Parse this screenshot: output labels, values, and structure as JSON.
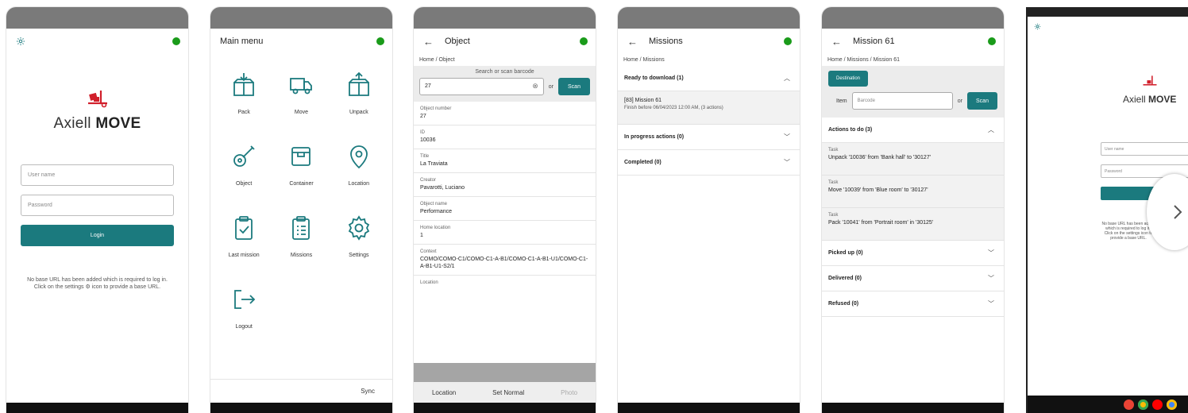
{
  "colors": {
    "accent": "#1b7a7e",
    "online": "#1a9b1a",
    "statusbar": "#7a7a7a"
  },
  "login": {
    "logo_light": "Axiell",
    "logo_bold": "MOVE",
    "username_placeholder": "User name",
    "password_placeholder": "Password",
    "login_label": "Login",
    "note": "No base URL has been added which is required to log in. Click on the settings ⚙ icon to provide a base URL."
  },
  "menu": {
    "title": "Main menu",
    "items": [
      {
        "label": "Pack",
        "icon": "pack-icon"
      },
      {
        "label": "Move",
        "icon": "truck-icon"
      },
      {
        "label": "Unpack",
        "icon": "unpack-icon"
      },
      {
        "label": "Object",
        "icon": "guitar-icon"
      },
      {
        "label": "Container",
        "icon": "container-icon"
      },
      {
        "label": "Location",
        "icon": "location-pin-icon"
      },
      {
        "label": "Last mission",
        "icon": "clipboard-check-icon"
      },
      {
        "label": "Missions",
        "icon": "clipboard-list-icon"
      },
      {
        "label": "Settings",
        "icon": "gear-icon"
      },
      {
        "label": "Logout",
        "icon": "logout-icon"
      }
    ],
    "sync_label": "Sync"
  },
  "object": {
    "title": "Object",
    "breadcrumb": "Home / Object",
    "search_label": "Search or scan barcode",
    "search_value": "27",
    "or_label": "or",
    "scan_label": "Scan",
    "props": [
      {
        "k": "Object number",
        "v": "27"
      },
      {
        "k": "ID",
        "v": "10036"
      },
      {
        "k": "Title",
        "v": "La Traviata"
      },
      {
        "k": "Creator",
        "v": "Pavarotti, Luciano"
      },
      {
        "k": "Object name",
        "v": "Performance"
      },
      {
        "k": "Home location",
        "v": "1"
      },
      {
        "k": "Context",
        "v": "COMO/COMO-C1/COMO-C1-A-B1/COMO-C1-A-B1-U1/COMO-C1-A-B1-U1-S2/1"
      },
      {
        "k": "Location",
        "v": ""
      }
    ],
    "bottom": {
      "location": "Location",
      "set_normal": "Set Normal",
      "photo": "Photo"
    }
  },
  "missions": {
    "title": "Missions",
    "breadcrumb": "Home / Missions",
    "ready_label": "Ready to download (1)",
    "mission_name": "[83] Mission 61",
    "mission_sub": "Finish before 06/04/2023 12:00 AM, (3 actions)",
    "in_progress_label": "In progress actions (0)",
    "completed_label": "Completed (0)"
  },
  "mission61": {
    "title": "Mission 61",
    "breadcrumb": "Home / Missions / Mission 61",
    "destination_label": "Destination",
    "item_label": "Item",
    "barcode_placeholder": "Barcode",
    "or_label": "or",
    "scan_label": "Scan",
    "actions_label": "Actions to do (3)",
    "tasks": [
      {
        "k": "Task",
        "v": "Unpack '10036' from 'Bank hall' to '30127'"
      },
      {
        "k": "Task",
        "v": "Move '10039' from 'Blue room' to '30127'"
      },
      {
        "k": "Task",
        "v": "Pack '10041' from 'Portrait room' in '30125'"
      }
    ],
    "picked_label": "Picked up (0)",
    "delivered_label": "Delivered (0)",
    "refused_label": "Refused (0)"
  },
  "tablet": {
    "logo_light": "Axiell",
    "logo_bold": "MOVE",
    "username_placeholder": "User name",
    "password_placeholder": "Password",
    "note": "No base URL has been added which is required to log in. Click on the settings icon to provide a base URL."
  }
}
